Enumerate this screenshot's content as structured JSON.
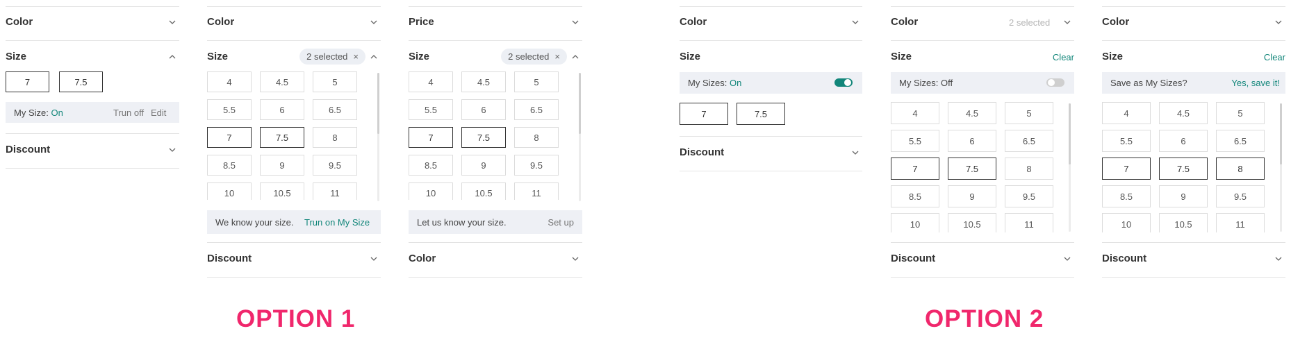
{
  "option_labels": {
    "one": "OPTION 1",
    "two": "OPTION 2"
  },
  "labels": {
    "color": "Color",
    "size": "Size",
    "price": "Price",
    "discount": "Discount",
    "two_selected": "2 selected",
    "clear": "Clear",
    "close_x": "×"
  },
  "sizes": [
    "4",
    "4.5",
    "5",
    "5.5",
    "6",
    "6.5",
    "7",
    "7.5",
    "8",
    "8.5",
    "9",
    "9.5",
    "10",
    "10.5",
    "11"
  ],
  "panel1": {
    "chips": [
      "7",
      "7.5"
    ],
    "my_size_label": "My Size: ",
    "my_size_state": "On",
    "turn_off": "Trun off",
    "edit": "Edit"
  },
  "panel2": {
    "selected": [
      "7",
      "7.5"
    ],
    "banner_text": "We know your size.",
    "banner_action": "Trun on My Size"
  },
  "panel3": {
    "selected": [
      "7",
      "7.5"
    ],
    "banner_text": "Let us know your size.",
    "banner_action": "Set up"
  },
  "panel4": {
    "my_sizes_label": "My Sizes: ",
    "my_sizes_state": "On",
    "toggle_on": true,
    "chips": [
      "7",
      "7.5"
    ]
  },
  "panel5": {
    "my_sizes_label": "My Sizes: ",
    "my_sizes_state": "Off",
    "toggle_on": false,
    "selected": [
      "7",
      "7.5"
    ]
  },
  "panel6": {
    "save_prompt": "Save as My Sizes?",
    "save_action": "Yes, save it!",
    "selected": [
      "7",
      "7.5",
      "8"
    ]
  },
  "colors": {
    "accent_teal": "#12867a",
    "option_pink": "#f0276c",
    "toggle_off": "#cfcfcf"
  }
}
